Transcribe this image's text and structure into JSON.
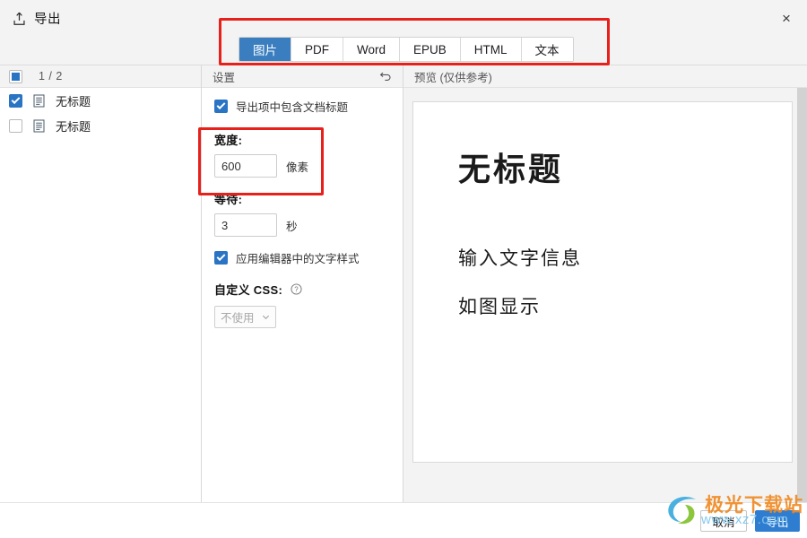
{
  "window": {
    "title": "导出",
    "export_icon": "export-upload-icon",
    "close_label": "×"
  },
  "tabs": {
    "items": [
      {
        "label": "图片",
        "active": true
      },
      {
        "label": "PDF",
        "active": false
      },
      {
        "label": "Word",
        "active": false
      },
      {
        "label": "EPUB",
        "active": false
      },
      {
        "label": "HTML",
        "active": false
      },
      {
        "label": "文本",
        "active": false
      }
    ]
  },
  "sidebar": {
    "count": "1 / 2",
    "select_all_state": "partial",
    "documents": [
      {
        "name": "无标题",
        "checked": true
      },
      {
        "name": "无标题",
        "checked": false
      }
    ]
  },
  "settings": {
    "header": "设置",
    "reset_icon": "undo-arrow-icon",
    "include_title": {
      "label": "导出项中包含文档标题",
      "checked": true
    },
    "width": {
      "label": "宽度:",
      "value": "600",
      "placeholder": "600",
      "unit": "像素"
    },
    "wait": {
      "label": "等待:",
      "value": "3",
      "placeholder": "3",
      "unit": "秒"
    },
    "apply_editor_style": {
      "label": "应用编辑器中的文字样式",
      "checked": true
    },
    "custom_css": {
      "label": "自定义 CSS:",
      "help_icon": "question-mark-icon",
      "selected": "不使用",
      "options": [
        "不使用"
      ]
    }
  },
  "preview": {
    "header": "预览 (仅供参考)",
    "page": {
      "title": "无标题",
      "paragraphs": [
        "输入文字信息",
        "如图显示"
      ]
    }
  },
  "footer": {
    "cancel_label": "取消",
    "export_label": "导出"
  },
  "watermark": {
    "brand": "极光下载站",
    "url": "www.xz7.com"
  },
  "colors": {
    "accent_blue": "#3a7ebf",
    "button_blue": "#2f7dd1",
    "checkbox_blue": "#2a74c4",
    "annotation_red": "#e8201b",
    "panel_gray": "#f3f3f3",
    "border_gray": "#d8d8d8",
    "watermark_orange": "#f08a22",
    "watermark_blue": "#7ec7ee"
  }
}
